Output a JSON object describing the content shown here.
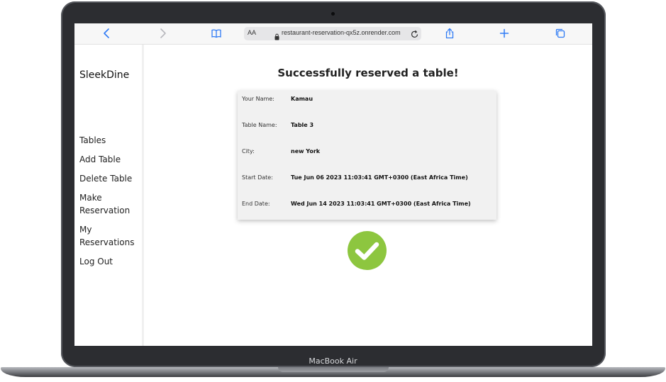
{
  "device": {
    "label": "MacBook Air"
  },
  "browser": {
    "text_size_label": "AA",
    "url": "restaurant-reservation-qx5z.onrender.com",
    "icons": [
      "back-icon",
      "forward-icon",
      "bookmarks-icon",
      "lock-icon",
      "reload-icon",
      "share-icon",
      "new-tab-icon",
      "tabs-icon"
    ]
  },
  "sidebar": {
    "brand": "SleekDine",
    "items": [
      {
        "label": "Tables"
      },
      {
        "label": "Add Table"
      },
      {
        "label": "Delete Table"
      },
      {
        "label": "Make Reservation"
      },
      {
        "label": "My Reservations"
      },
      {
        "label": "Log Out"
      }
    ],
    "socials": [
      "twitter-icon",
      "facebook-icon",
      "linkedin-icon",
      "github-icon"
    ]
  },
  "main": {
    "title": "Successfully reserved a table!",
    "details": [
      {
        "label": "Your Name:",
        "value": "Kamau"
      },
      {
        "label": "Table Name:",
        "value": "Table 3"
      },
      {
        "label": "City:",
        "value": "new York"
      },
      {
        "label": "Start Date:",
        "value": "Tue Jun 06 2023 11:03:41 GMT+0300 (East Africa Time)"
      },
      {
        "label": "End Date:",
        "value": "Wed Jun 14 2023 11:03:41 GMT+0300 (East Africa Time)"
      }
    ]
  },
  "colors": {
    "success_green": "#8dc63f",
    "card_bg": "#f1f1f1",
    "accent_blue": "#2f7bf5"
  }
}
